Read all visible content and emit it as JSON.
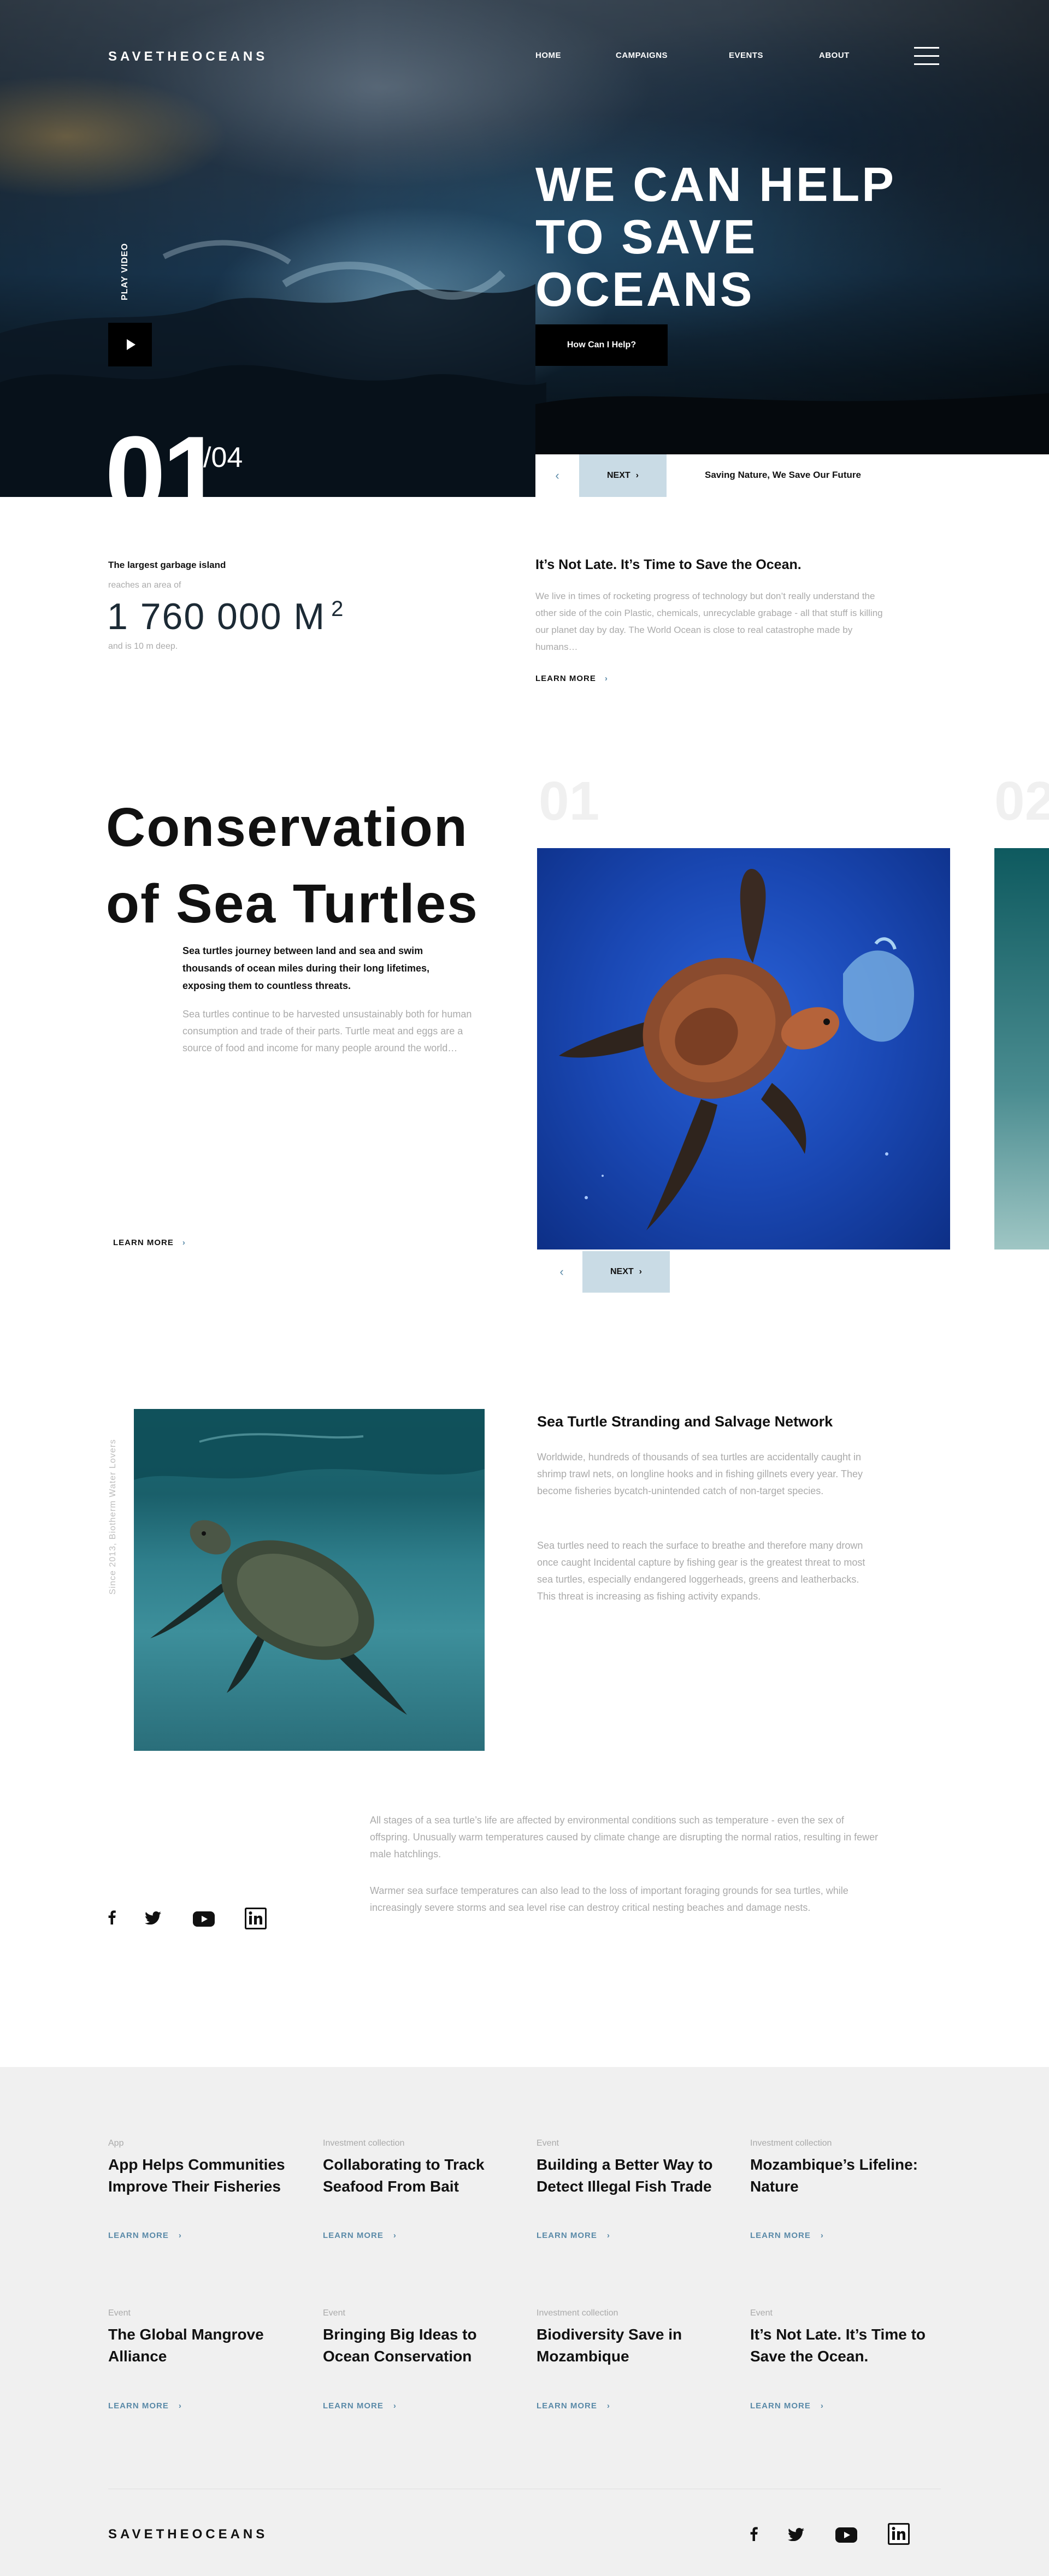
{
  "header": {
    "logo": "SAVETHEOCEANS",
    "nav": [
      "HOME",
      "CAMPAIGNS",
      "EVENTS",
      "ABOUT"
    ]
  },
  "hero": {
    "play_label": "PLAY VIDEO",
    "title": "WE CAN HELP TO SAVE OCEANS",
    "cta": "How Can I Help?",
    "slide_current": "01",
    "slide_total": "/04",
    "next_label": "NEXT",
    "caption": "Saving Nature, We Save Our Future"
  },
  "stats": {
    "title": "The largest garbage island",
    "subtitle": "reaches an area of",
    "value": "1 760 000 M",
    "unit_sup": "2",
    "note": "and is 10 m deep."
  },
  "intro": {
    "title": "It’s Not Late. It’s Time to Save the Ocean.",
    "text": "We live in times of rocketing progress of technology but don’t really understand the other side of the coin Plastic, chemicals, unrecyclable grabage - all that stuff is killing our planet day by day. The World Ocean is close to real catastrophe made by humans…",
    "learn_more": "LEARN MORE"
  },
  "conservation": {
    "title": "Conservation of Sea Turtles",
    "lead": "Sea turtles journey between land and sea and swim thousands of ocean miles during their long lifetimes, exposing them to countless threats.",
    "text": "Sea turtles continue to be harvested unsustainably both for human consumption and trade of their parts. Turtle meat and eggs are a source of food and income for many people around the world…",
    "learn_more": "LEARN MORE",
    "card_numbers": [
      "01",
      "02"
    ],
    "next_label": "NEXT"
  },
  "stranding": {
    "since": "Since 2013, Biotherm Water Lovers",
    "title": "Sea Turtle Stranding and Salvage Network",
    "p1": "Worldwide, hundreds of thousands of sea turtles are accidentally caught in shrimp trawl nets, on longline hooks and in fishing gillnets every year. They become fisheries bycatch-unintended catch of non-target species.",
    "p2": "Sea turtles need to reach the surface to breathe and therefore many drown once caught Incidental capture by fishing  gear is the greatest threat to most sea turtles, especially endangered loggerheads, greens and leatherbacks. This threat is increasing as fishing activity expands.",
    "p3": "All stages of a sea turtle’s life are affected by environmental conditions such as temperature - even the sex of offspring. Unusually warm temperatures caused by climate change are disrupting the normal ratios, resulting in fewer male hatchlings.",
    "p4": "Warmer sea surface temperatures can also lead to the loss of important foraging grounds for sea turtles, while increasingly severe storms and sea level rise can destroy critical nesting beaches and damage nests."
  },
  "news": {
    "learn_more": "LEARN MORE",
    "items": [
      {
        "category": "App",
        "title": "App Helps Communities Improve Their Fisheries"
      },
      {
        "category": "Investment collection",
        "title": "Collaborating to Track Seafood From Bait"
      },
      {
        "category": "Event",
        "title": "Building a Better Way to Detect Illegal Fish Trade"
      },
      {
        "category": "Investment collection",
        "title": "Mozambique’s Lifeline: Nature"
      },
      {
        "category": "Event",
        "title": "The Global Mangrove Alliance"
      },
      {
        "category": "Event",
        "title": "Bringing Big Ideas to Ocean Conservation"
      },
      {
        "category": "Investment collection",
        "title": "Biodiversity Save in Mozambique"
      },
      {
        "category": "Event",
        "title": "It’s Not Late. It’s Time to Save the Ocean."
      }
    ]
  },
  "footer": {
    "logo": "SAVETHEOCEANS"
  },
  "colors": {
    "accent": "#5a8aa8",
    "next_button_bg": "#c9dbe5",
    "news_bg": "#f0f0f0"
  },
  "icons": [
    "play-icon",
    "menu-icon",
    "chevron-left-icon",
    "chevron-right-icon",
    "facebook-icon",
    "twitter-icon",
    "youtube-icon",
    "linkedin-icon"
  ]
}
